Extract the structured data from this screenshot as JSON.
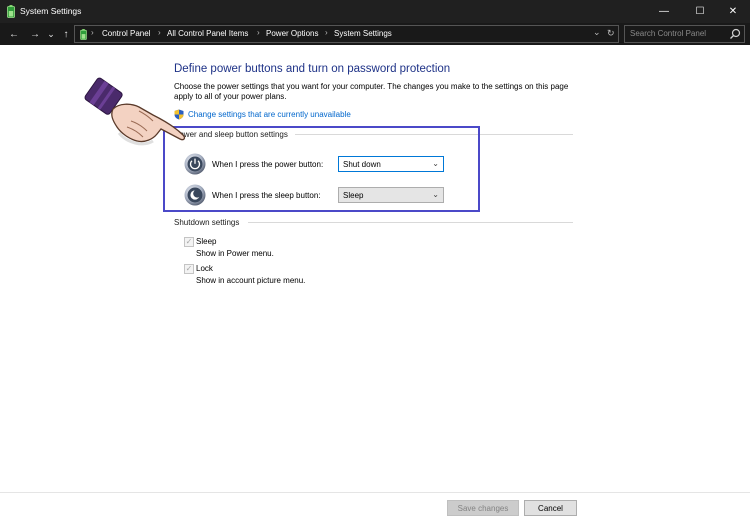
{
  "window": {
    "title": "System Settings",
    "minimize": "—",
    "maximize": "☐",
    "close": "✕"
  },
  "nav": {
    "back": "←",
    "forward": "→",
    "recent": "⌄",
    "up": "↑"
  },
  "address": {
    "separator": "›",
    "breadcrumbs": [
      "Control Panel",
      "All Control Panel Items",
      "Power Options",
      "System Settings"
    ],
    "dropdown": "⌄",
    "refresh": "↻"
  },
  "search": {
    "placeholder": "Search Control Panel"
  },
  "page": {
    "heading": "Define power buttons and turn on password protection",
    "description": "Choose the power settings that you want for your computer. The changes you make to the settings on this page apply to all of your power plans.",
    "change_link": "Change settings that are currently unavailable"
  },
  "power_sleep": {
    "group_label": "Power and sleep button settings",
    "power_label": "When I press the power button:",
    "power_value": "Shut down",
    "sleep_label": "When I press the sleep button:",
    "sleep_value": "Sleep",
    "chevron": "⌄"
  },
  "shutdown": {
    "group_label": "Shutdown settings",
    "items": [
      {
        "label": "Sleep",
        "sub": "Show in Power menu.",
        "check": "✓"
      },
      {
        "label": "Lock",
        "sub": "Show in account picture menu.",
        "check": "✓"
      }
    ]
  },
  "footer": {
    "save": "Save changes",
    "cancel": "Cancel"
  },
  "colors": {
    "heading": "#1e3287",
    "link": "#0066cc",
    "highlight_border": "#4b49c8",
    "titlebar": "#202020"
  },
  "icons": {
    "app": "battery-icon",
    "shield": "uac-shield-icon",
    "power": "power-button-icon",
    "sleep": "sleep-moon-icon",
    "pointer": "pointing-hand-icon",
    "search": "search-icon"
  }
}
